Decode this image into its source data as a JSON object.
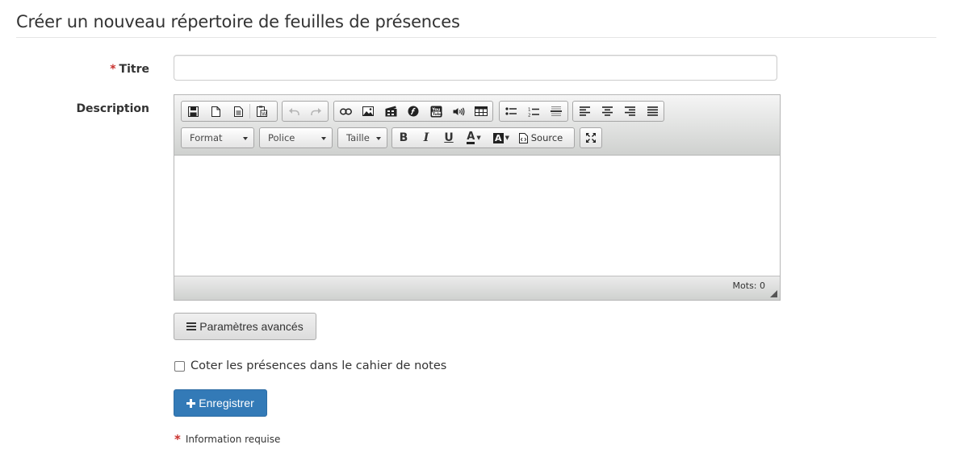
{
  "page": {
    "title": "Créer un nouveau répertoire de feuilles de présences"
  },
  "form": {
    "title_field": {
      "required_mark": "*",
      "label": "Titre",
      "value": ""
    },
    "description": {
      "label": "Description"
    },
    "editor": {
      "toolbar_row1": [
        {
          "group": "document",
          "buttons": [
            "save-icon",
            "new-page-icon",
            "templates-icon",
            "paste-icon"
          ]
        },
        {
          "group": "history",
          "buttons": [
            "undo-icon",
            "redo-icon"
          ]
        },
        {
          "group": "insert",
          "buttons": [
            "link-icon",
            "image-icon",
            "video-icon",
            "flash-icon",
            "youtube-icon",
            "audio-icon",
            "table-icon"
          ]
        },
        {
          "group": "lists",
          "buttons": [
            "bulleted-list-icon",
            "numbered-list-icon",
            "horizontal-rule-icon"
          ]
        },
        {
          "group": "align",
          "buttons": [
            "align-left-icon",
            "align-center-icon",
            "align-right-icon",
            "justify-icon"
          ]
        }
      ],
      "format_combo": "Format",
      "font_combo": "Police",
      "size_combo": "Taille",
      "bold": "B",
      "italic": "I",
      "underline": "U",
      "text_color": "A",
      "bg_color": "A",
      "source_label": "Source",
      "word_count": "Mots: 0"
    },
    "advanced_button": "Paramètres avancés",
    "gradebook_checkbox": {
      "label": "Coter les présences dans le cahier de notes",
      "checked": false
    },
    "submit_button": "Enregistrer",
    "required_note": {
      "mark": "*",
      "text": "Information requise"
    }
  },
  "colors": {
    "primary": "#337ab7",
    "required": "#c9302c"
  }
}
